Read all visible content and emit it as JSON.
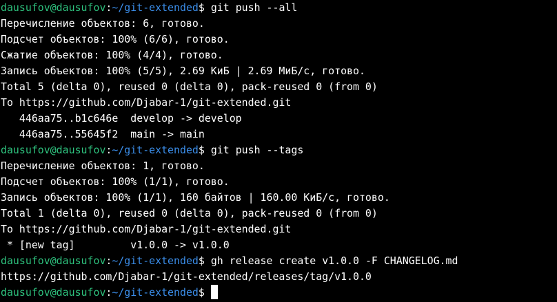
{
  "terminal": {
    "user_host": "dausufov@dausufov",
    "cwd": "~/git-extended",
    "prompt_symbol": "$",
    "blocks": [
      {
        "command": "git push --all",
        "output": [
          "Перечисление объектов: 6, готово.",
          "Подсчет объектов: 100% (6/6), готово.",
          "Сжатие объектов: 100% (4/4), готово.",
          "Запись объектов: 100% (5/5), 2.69 КиБ | 2.69 МиБ/с, готово.",
          "Total 5 (delta 0), reused 0 (delta 0), pack-reused 0 (from 0)",
          "To https://github.com/Djabar-1/git-extended.git",
          "   446aa75..b1c646e  develop -> develop",
          "   446aa75..55645f2  main -> main"
        ]
      },
      {
        "command": "git push --tags",
        "output": [
          "Перечисление объектов: 1, готово.",
          "Подсчет объектов: 100% (1/1), готово.",
          "Запись объектов: 100% (1/1), 160 байтов | 160.00 КиБ/с, готово.",
          "Total 1 (delta 0), reused 0 (delta 0), pack-reused 0 (from 0)",
          "To https://github.com/Djabar-1/git-extended.git",
          " * [new tag]         v1.0.0 -> v1.0.0"
        ]
      },
      {
        "command": "gh release create v1.0.0 -F CHANGELOG.md",
        "output": [
          "https://github.com/Djabar-1/git-extended/releases/tag/v1.0.0"
        ]
      }
    ],
    "current_input": ""
  },
  "colors": {
    "background": "#000000",
    "text": "#ffffff",
    "user_host": "#2ec27e",
    "path": "#3b8eea"
  }
}
